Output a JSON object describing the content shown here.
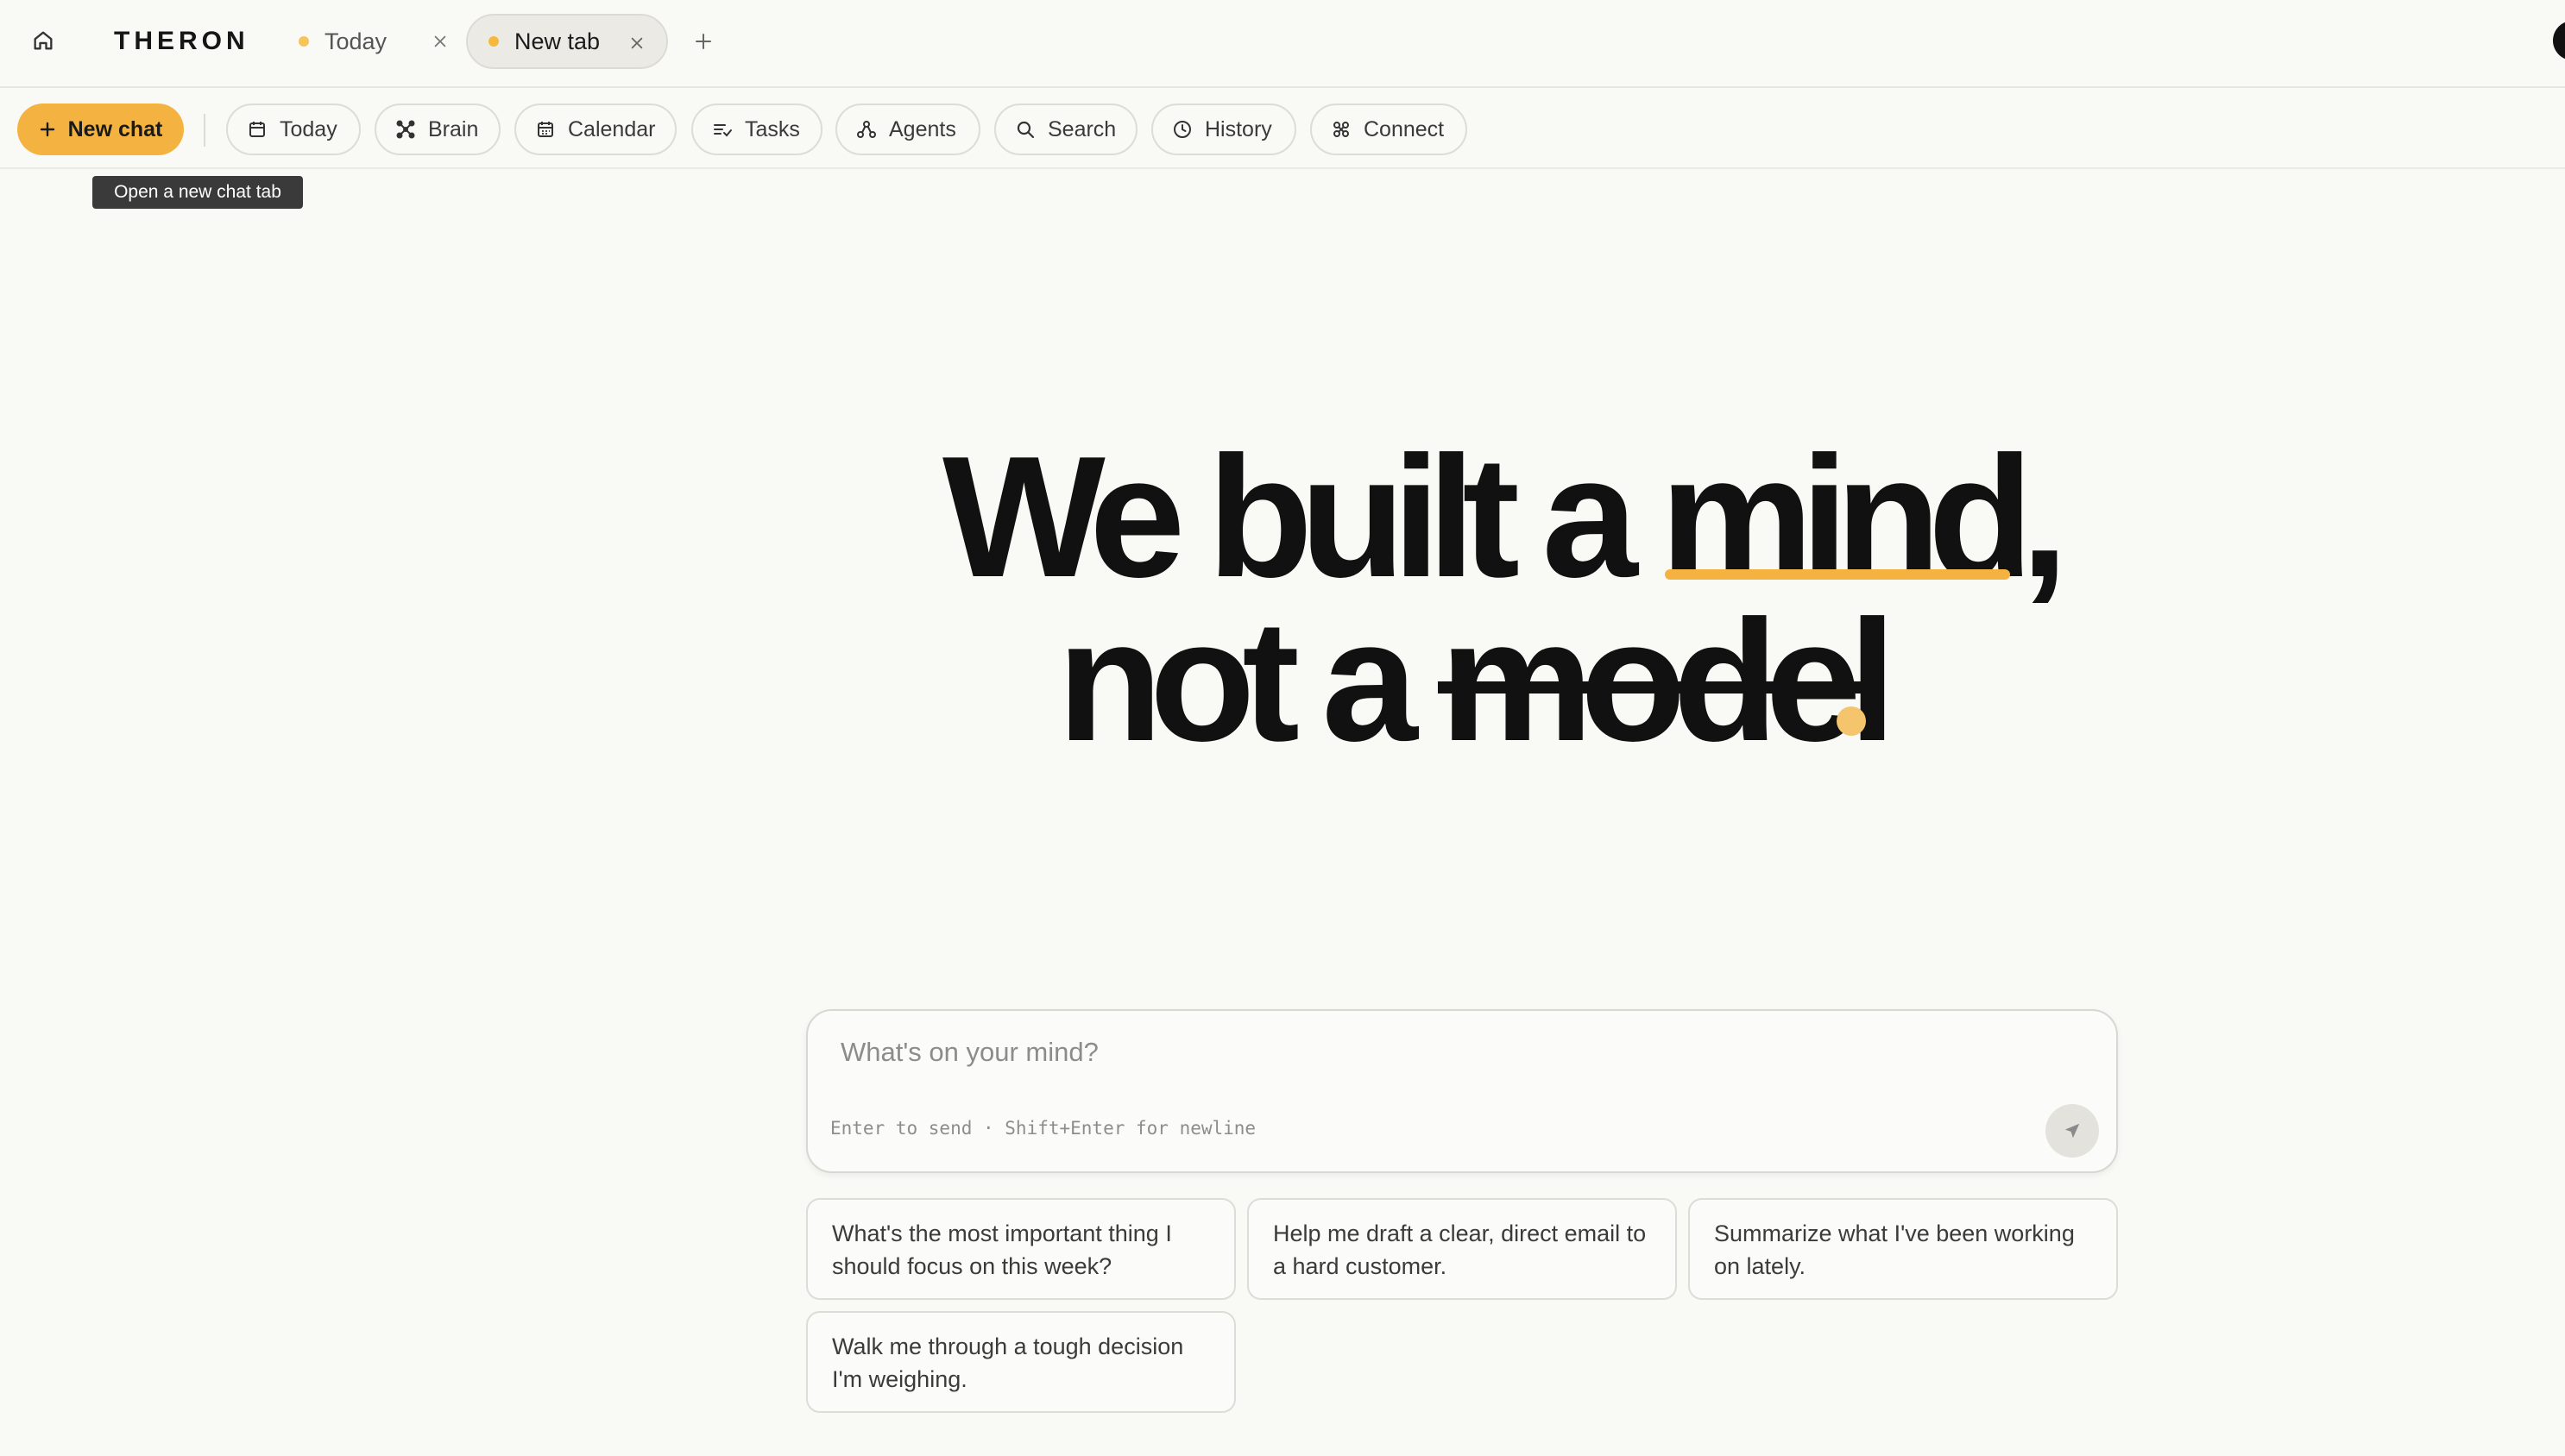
{
  "app": {
    "brand": "THERON"
  },
  "tabs": [
    {
      "label": "Today",
      "active": false
    },
    {
      "label": "New tab",
      "active": true
    }
  ],
  "toolbar": {
    "new_chat": "New chat",
    "tooltip": "Open a new chat tab",
    "items": [
      {
        "label": "Today",
        "icon": "calendar-icon"
      },
      {
        "label": "Brain",
        "icon": "brain-network-icon"
      },
      {
        "label": "Calendar",
        "icon": "calendar-grid-icon"
      },
      {
        "label": "Tasks",
        "icon": "tasks-list-icon"
      },
      {
        "label": "Agents",
        "icon": "agents-icon"
      },
      {
        "label": "Search",
        "icon": "search-icon"
      },
      {
        "label": "History",
        "icon": "clock-icon"
      },
      {
        "label": "Connect",
        "icon": "connect-icon"
      }
    ]
  },
  "hero": {
    "line1_pre": "We built a ",
    "line1_highlight": "mind",
    "line1_post": ",",
    "line2_pre": "not a ",
    "line2_struck": "model"
  },
  "composer": {
    "placeholder": "What's on your mind?",
    "hint": "Enter to send · Shift+Enter for newline"
  },
  "suggestions": [
    "What's the most important thing I should focus on this week?",
    "Help me draft a clear, direct email to a hard customer.",
    "Summarize what I've been working on lately.",
    "Walk me through a tough decision I'm weighing."
  ],
  "colors": {
    "accent": "#f4b340",
    "background": "#f9f9f6",
    "text": "#111111"
  }
}
